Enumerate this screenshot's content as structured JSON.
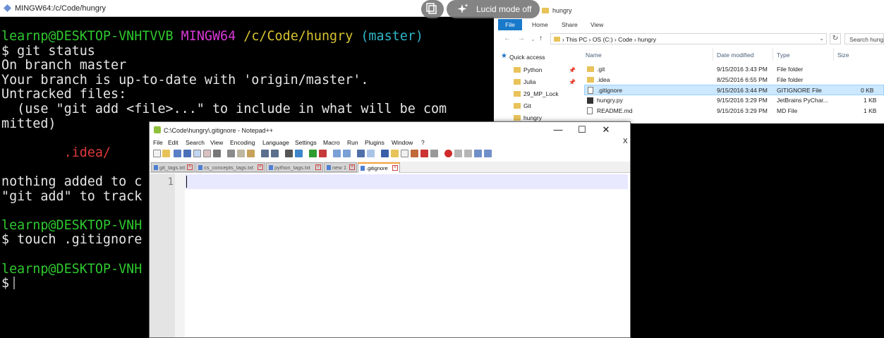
{
  "terminal": {
    "title": "MINGW64:/c/Code/hungry",
    "prompt_user": "learnp@DESKTOP-VNHTVVB",
    "prompt_env": "MINGW64",
    "prompt_path": "/c/Code/hungry",
    "prompt_branch": "(master)",
    "cmd1": "$ git status",
    "out1": "On branch master",
    "out2": "Your branch is up-to-date with 'origin/master'.",
    "out3": "Untracked files:",
    "out4": "  (use \"git add <file>...\" to include in what will be com",
    "out5": "mitted)",
    "untracked": "        .idea/",
    "out6": "nothing added to c",
    "out7": "\"git add\" to track",
    "prompt2": "learnp@DESKTOP-VNH",
    "cmd2": "$ touch .gitignore",
    "prompt3": "learnp@DESKTOP-VNH",
    "cmd3": "$"
  },
  "overlay": {
    "copy_icon": "copy-icon",
    "lucid_label": "Lucid mode off"
  },
  "explorer": {
    "title": "hungry",
    "ribbon_tabs": [
      "File",
      "Home",
      "Share",
      "View"
    ],
    "address_crumbs": "›  This PC  ›  OS (C:)  ›  Code  ›  hungry",
    "search_placeholder": "Search hung",
    "quick_access": "Quick access",
    "nav_items": [
      "Python",
      "Julia",
      "29_MP_Lock",
      "Git",
      "hungry"
    ],
    "columns": {
      "name": "Name",
      "date": "Date modified",
      "type": "Type",
      "size": "Size"
    },
    "files": [
      {
        "name": ".git",
        "date": "9/15/2016 3:43 PM",
        "type": "File folder",
        "size": "",
        "icon": "folder"
      },
      {
        "name": ".idea",
        "date": "8/25/2016 6:55 PM",
        "type": "File folder",
        "size": "",
        "icon": "folder"
      },
      {
        "name": ".gitignore",
        "date": "9/15/2016 3:44 PM",
        "type": "GITIGNORE File",
        "size": "0 KB",
        "icon": "doc"
      },
      {
        "name": "hungry.py",
        "date": "9/15/2016 3:29 PM",
        "type": "JetBrains PyChar...",
        "size": "1 KB",
        "icon": "py"
      },
      {
        "name": "README.md",
        "date": "9/15/2016 3:29 PM",
        "type": "MD File",
        "size": "1 KB",
        "icon": "doc"
      }
    ]
  },
  "notepad": {
    "title": "C:\\Code\\hungry\\.gitignore - Notepad++",
    "window_controls": {
      "minimize": "—",
      "maximize": "☐",
      "close": "✕"
    },
    "menu": [
      "File",
      "Edit",
      "Search",
      "View",
      "Encoding",
      "Language",
      "Settings",
      "Macro",
      "Run",
      "Plugins",
      "Window",
      "?"
    ],
    "menu_close": "X",
    "tabs": [
      {
        "label": "git_tags.txt",
        "active": false
      },
      {
        "label": "cs_concepts_tags.txt",
        "active": false
      },
      {
        "label": "python_tags.txt",
        "active": false
      },
      {
        "label": "new 1",
        "active": false
      },
      {
        "label": ".gitignore",
        "active": true
      }
    ],
    "line_number": "1"
  },
  "colors": {
    "terminal_green": "#2ec92e",
    "terminal_magenta": "#d838d8",
    "terminal_yellow": "#d6c22f",
    "terminal_cyan": "#2fb7c9",
    "terminal_red": "#e03a3a",
    "explorer_file_tab": "#1979ca",
    "selected_row": "#cce8ff",
    "npp_active_tab_accent": "#f9a13b"
  }
}
